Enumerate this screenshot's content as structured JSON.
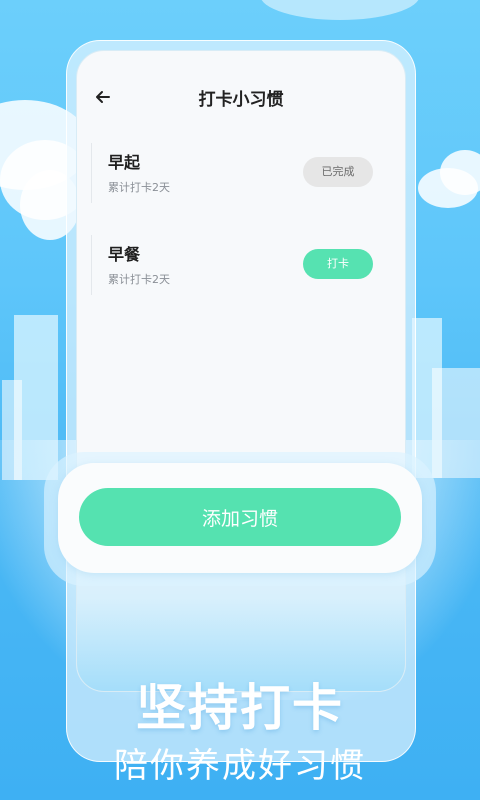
{
  "header": {
    "back_icon": "arrow-left-icon",
    "title": "打卡小习惯"
  },
  "habits": [
    {
      "name": "早起",
      "subtitle": "累计打卡2天",
      "action_label": "已完成",
      "status": "done"
    },
    {
      "name": "早餐",
      "subtitle": "累计打卡2天",
      "action_label": "打卡",
      "status": "pending"
    }
  ],
  "add_button": {
    "label": "添加习惯"
  },
  "promo": {
    "headline": "坚持打卡",
    "subheadline": "陪你养成好习惯"
  },
  "colors": {
    "accent_green": "#56e2b1",
    "sky_blue": "#5ec6fa",
    "done_gray": "#e6e6e6"
  }
}
